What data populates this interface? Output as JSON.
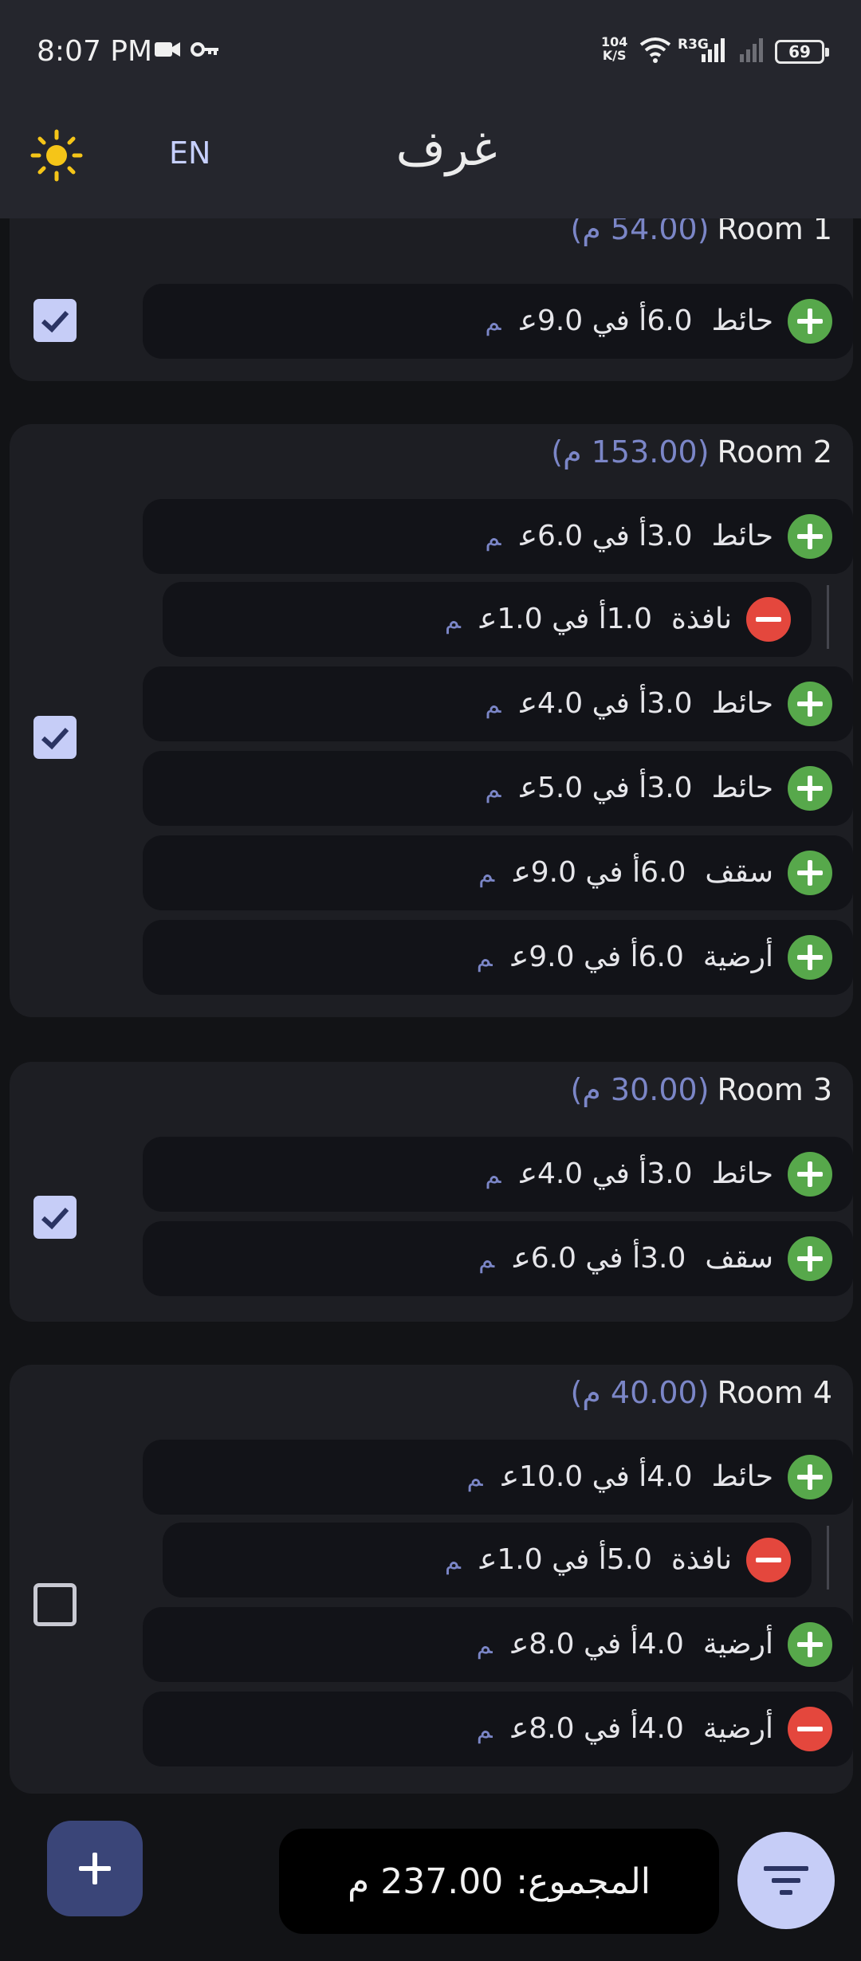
{
  "status_bar": {
    "time": "8:07 PM",
    "net_speed_value": "104",
    "net_speed_unit": "K/S",
    "network_type": "R3G",
    "battery": "69"
  },
  "app_bar": {
    "title": "غرف",
    "language": "EN",
    "theme_icon": "sun-icon"
  },
  "rooms": [
    {
      "name": "Room 1",
      "area": "(54.00 م)",
      "checked": true,
      "items": [
        {
          "type": "add",
          "label": "حائط",
          "dims": "6.0أ في 9.0ع",
          "unit": "م"
        }
      ]
    },
    {
      "name": "Room 2",
      "area": "(153.00 م)",
      "checked": true,
      "items": [
        {
          "type": "add",
          "label": "حائط",
          "dims": "3.0أ في 6.0ع",
          "unit": "م"
        },
        {
          "type": "subtract",
          "label": "نافذة",
          "dims": "1.0أ في 1.0ع",
          "unit": "م"
        },
        {
          "type": "add",
          "label": "حائط",
          "dims": "3.0أ في 4.0ع",
          "unit": "م"
        },
        {
          "type": "add",
          "label": "حائط",
          "dims": "3.0أ في 5.0ع",
          "unit": "م"
        },
        {
          "type": "add",
          "label": "سقف",
          "dims": "6.0أ في 9.0ع",
          "unit": "م"
        },
        {
          "type": "add",
          "label": "أرضية",
          "dims": "6.0أ في 9.0ع",
          "unit": "م"
        }
      ]
    },
    {
      "name": "Room 3",
      "area": "(30.00 م)",
      "checked": true,
      "items": [
        {
          "type": "add",
          "label": "حائط",
          "dims": "3.0أ في 4.0ع",
          "unit": "م"
        },
        {
          "type": "add",
          "label": "سقف",
          "dims": "3.0أ في 6.0ع",
          "unit": "م"
        }
      ]
    },
    {
      "name": "Room 4",
      "area": "(40.00 م)",
      "checked": false,
      "items": [
        {
          "type": "add",
          "label": "حائط",
          "dims": "4.0أ في 10.0ع",
          "unit": "م"
        },
        {
          "type": "subtract",
          "label": "نافذة",
          "dims": "5.0أ في 1.0ع",
          "unit": "م"
        },
        {
          "type": "add",
          "label": "أرضية",
          "dims": "4.0أ في 8.0ع",
          "unit": "م"
        },
        {
          "type": "subtract",
          "label": "أرضية",
          "dims": "4.0أ في 8.0ع",
          "unit": "م"
        }
      ]
    }
  ],
  "bottom": {
    "total_label": "المجموع:",
    "total_value": "237.00 م",
    "add_icon": "plus-icon",
    "filter_icon": "filter-icon"
  },
  "colors": {
    "background": "#121316",
    "card": "#1d1e23",
    "accent": "#c6cdf7",
    "add": "#57a84b",
    "subtract": "#e4473d",
    "area_text": "#7b86c7"
  }
}
